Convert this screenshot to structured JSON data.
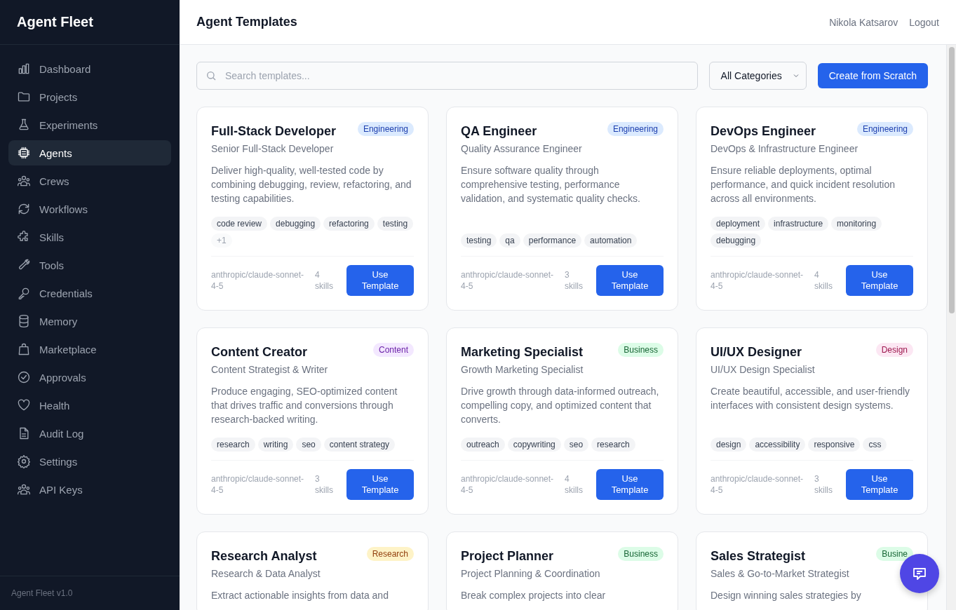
{
  "sidebar": {
    "brand": "Agent Fleet",
    "items": [
      {
        "label": "Dashboard",
        "selected": false
      },
      {
        "label": "Projects",
        "selected": false
      },
      {
        "label": "Experiments",
        "selected": false
      },
      {
        "label": "Agents",
        "selected": true
      },
      {
        "label": "Crews",
        "selected": false
      },
      {
        "label": "Workflows",
        "selected": false
      },
      {
        "label": "Skills",
        "selected": false
      },
      {
        "label": "Tools",
        "selected": false
      },
      {
        "label": "Credentials",
        "selected": false
      },
      {
        "label": "Memory",
        "selected": false
      },
      {
        "label": "Marketplace",
        "selected": false
      },
      {
        "label": "Approvals",
        "selected": false
      },
      {
        "label": "Health",
        "selected": false
      },
      {
        "label": "Audit Log",
        "selected": false
      },
      {
        "label": "Settings",
        "selected": false
      },
      {
        "label": "API Keys",
        "selected": false
      }
    ],
    "version": "Agent Fleet v1.0"
  },
  "header": {
    "title": "Agent Templates",
    "user": "Nikola Katsarov",
    "logout": "Logout"
  },
  "toolbar": {
    "search": {
      "placeholder": "Search templates..."
    },
    "category": "All Categories",
    "create_button": "Create from Scratch"
  },
  "templates": [
    {
      "title": "Full-Stack Developer",
      "subtitle": "Senior Full-Stack Developer",
      "category": {
        "label": "Engineering",
        "kind": "engineering"
      },
      "description": "Deliver high-quality, well-tested code by combining debugging, review, refactoring, and testing capabilities.",
      "tags": [
        "code review",
        "debugging",
        "refactoring",
        "testing"
      ],
      "more": "+1",
      "model": "anthropic/claude-sonnet-4-5",
      "skills": "4 skills",
      "button": "Use Template"
    },
    {
      "title": "QA Engineer",
      "subtitle": "Quality Assurance Engineer",
      "category": {
        "label": "Engineering",
        "kind": "engineering"
      },
      "description": "Ensure software quality through comprehensive testing, performance validation, and systematic quality checks.",
      "tags": [
        "testing",
        "qa",
        "performance",
        "automation"
      ],
      "model": "anthropic/claude-sonnet-4-5",
      "skills": "3 skills",
      "button": "Use Template"
    },
    {
      "title": "DevOps Engineer",
      "subtitle": "DevOps & Infrastructure Engineer",
      "category": {
        "label": "Engineering",
        "kind": "engineering"
      },
      "description": "Ensure reliable deployments, optimal performance, and quick incident resolution across all environments.",
      "tags": [
        "deployment",
        "infrastructure",
        "monitoring",
        "debugging"
      ],
      "model": "anthropic/claude-sonnet-4-5",
      "skills": "4 skills",
      "button": "Use Template"
    },
    {
      "title": "Content Creator",
      "subtitle": "Content Strategist & Writer",
      "category": {
        "label": "Content",
        "kind": "content"
      },
      "description": "Produce engaging, SEO-optimized content that drives traffic and conversions through research-backed writing.",
      "tags": [
        "research",
        "writing",
        "seo",
        "content strategy"
      ],
      "model": "anthropic/claude-sonnet-4-5",
      "skills": "3 skills",
      "button": "Use Template"
    },
    {
      "title": "Marketing Specialist",
      "subtitle": "Growth Marketing Specialist",
      "category": {
        "label": "Business",
        "kind": "business"
      },
      "description": "Drive growth through data-informed outreach, compelling copy, and optimized content that converts.",
      "tags": [
        "outreach",
        "copywriting",
        "seo",
        "research"
      ],
      "model": "anthropic/claude-sonnet-4-5",
      "skills": "4 skills",
      "button": "Use Template"
    },
    {
      "title": "UI/UX Designer",
      "subtitle": "UI/UX Design Specialist",
      "category": {
        "label": "Design",
        "kind": "design"
      },
      "description": "Create beautiful, accessible, and user-friendly interfaces with consistent design systems.",
      "tags": [
        "design",
        "accessibility",
        "responsive",
        "css"
      ],
      "model": "anthropic/claude-sonnet-4-5",
      "skills": "3 skills",
      "button": "Use Template"
    },
    {
      "title": "Research Analyst",
      "subtitle": "Research & Data Analyst",
      "category": {
        "label": "Research",
        "kind": "research"
      },
      "description": "Extract actionable insights from data and"
    },
    {
      "title": "Project Planner",
      "subtitle": "Project Planning & Coordination",
      "category": {
        "label": "Business",
        "kind": "business"
      },
      "description": "Break complex projects into clear"
    },
    {
      "title": "Sales Strategist",
      "subtitle": "Sales & Go-to-Market Strategist",
      "category": {
        "label": "Busine",
        "kind": "business"
      },
      "description": "Design winning sales strategies by"
    }
  ]
}
